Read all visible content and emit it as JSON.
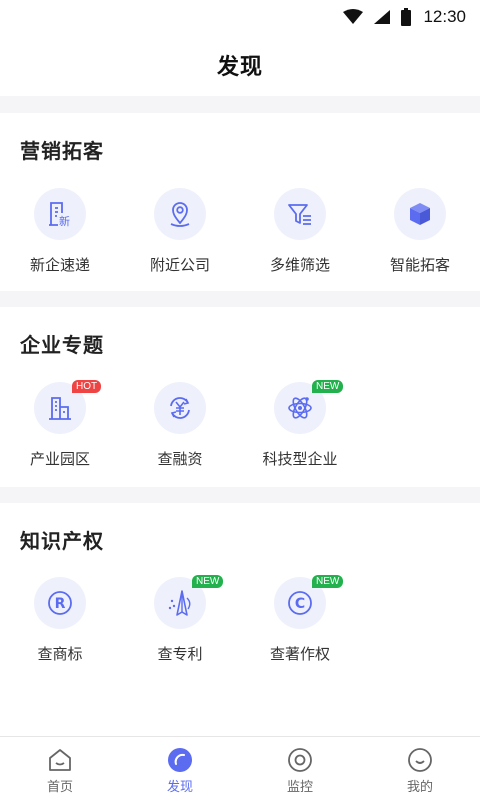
{
  "status": {
    "time": "12:30"
  },
  "header": {
    "title": "发现"
  },
  "sections": [
    {
      "title": "营销拓客",
      "items": [
        {
          "label": "新企速递",
          "icon": "new-company-icon",
          "badge": ""
        },
        {
          "label": "附近公司",
          "icon": "location-pin-icon",
          "badge": ""
        },
        {
          "label": "多维筛选",
          "icon": "filter-icon",
          "badge": ""
        },
        {
          "label": "智能拓客",
          "icon": "cube-icon",
          "badge": ""
        }
      ]
    },
    {
      "title": "企业专题",
      "items": [
        {
          "label": "产业园区",
          "icon": "industrial-park-icon",
          "badge": "HOT"
        },
        {
          "label": "查融资",
          "icon": "yuan-refresh-icon",
          "badge": ""
        },
        {
          "label": "科技型企业",
          "icon": "atom-icon",
          "badge": "NEW"
        }
      ]
    },
    {
      "title": "知识产权",
      "items": [
        {
          "label": "查商标",
          "icon": "registered-trademark-icon",
          "badge": ""
        },
        {
          "label": "查专利",
          "icon": "patent-icon",
          "badge": "NEW"
        },
        {
          "label": "查著作权",
          "icon": "copyright-icon",
          "badge": "NEW"
        }
      ]
    }
  ],
  "tabs": [
    {
      "label": "首页",
      "icon": "home-icon",
      "active": false
    },
    {
      "label": "发现",
      "icon": "discover-icon",
      "active": true
    },
    {
      "label": "监控",
      "icon": "monitor-icon",
      "active": false
    },
    {
      "label": "我的",
      "icon": "profile-icon",
      "active": false
    }
  ],
  "colors": {
    "accent": "#5b6cf0",
    "icon_bg": "#eef0fb",
    "hot": "#ef4444",
    "new": "#22b14c"
  }
}
